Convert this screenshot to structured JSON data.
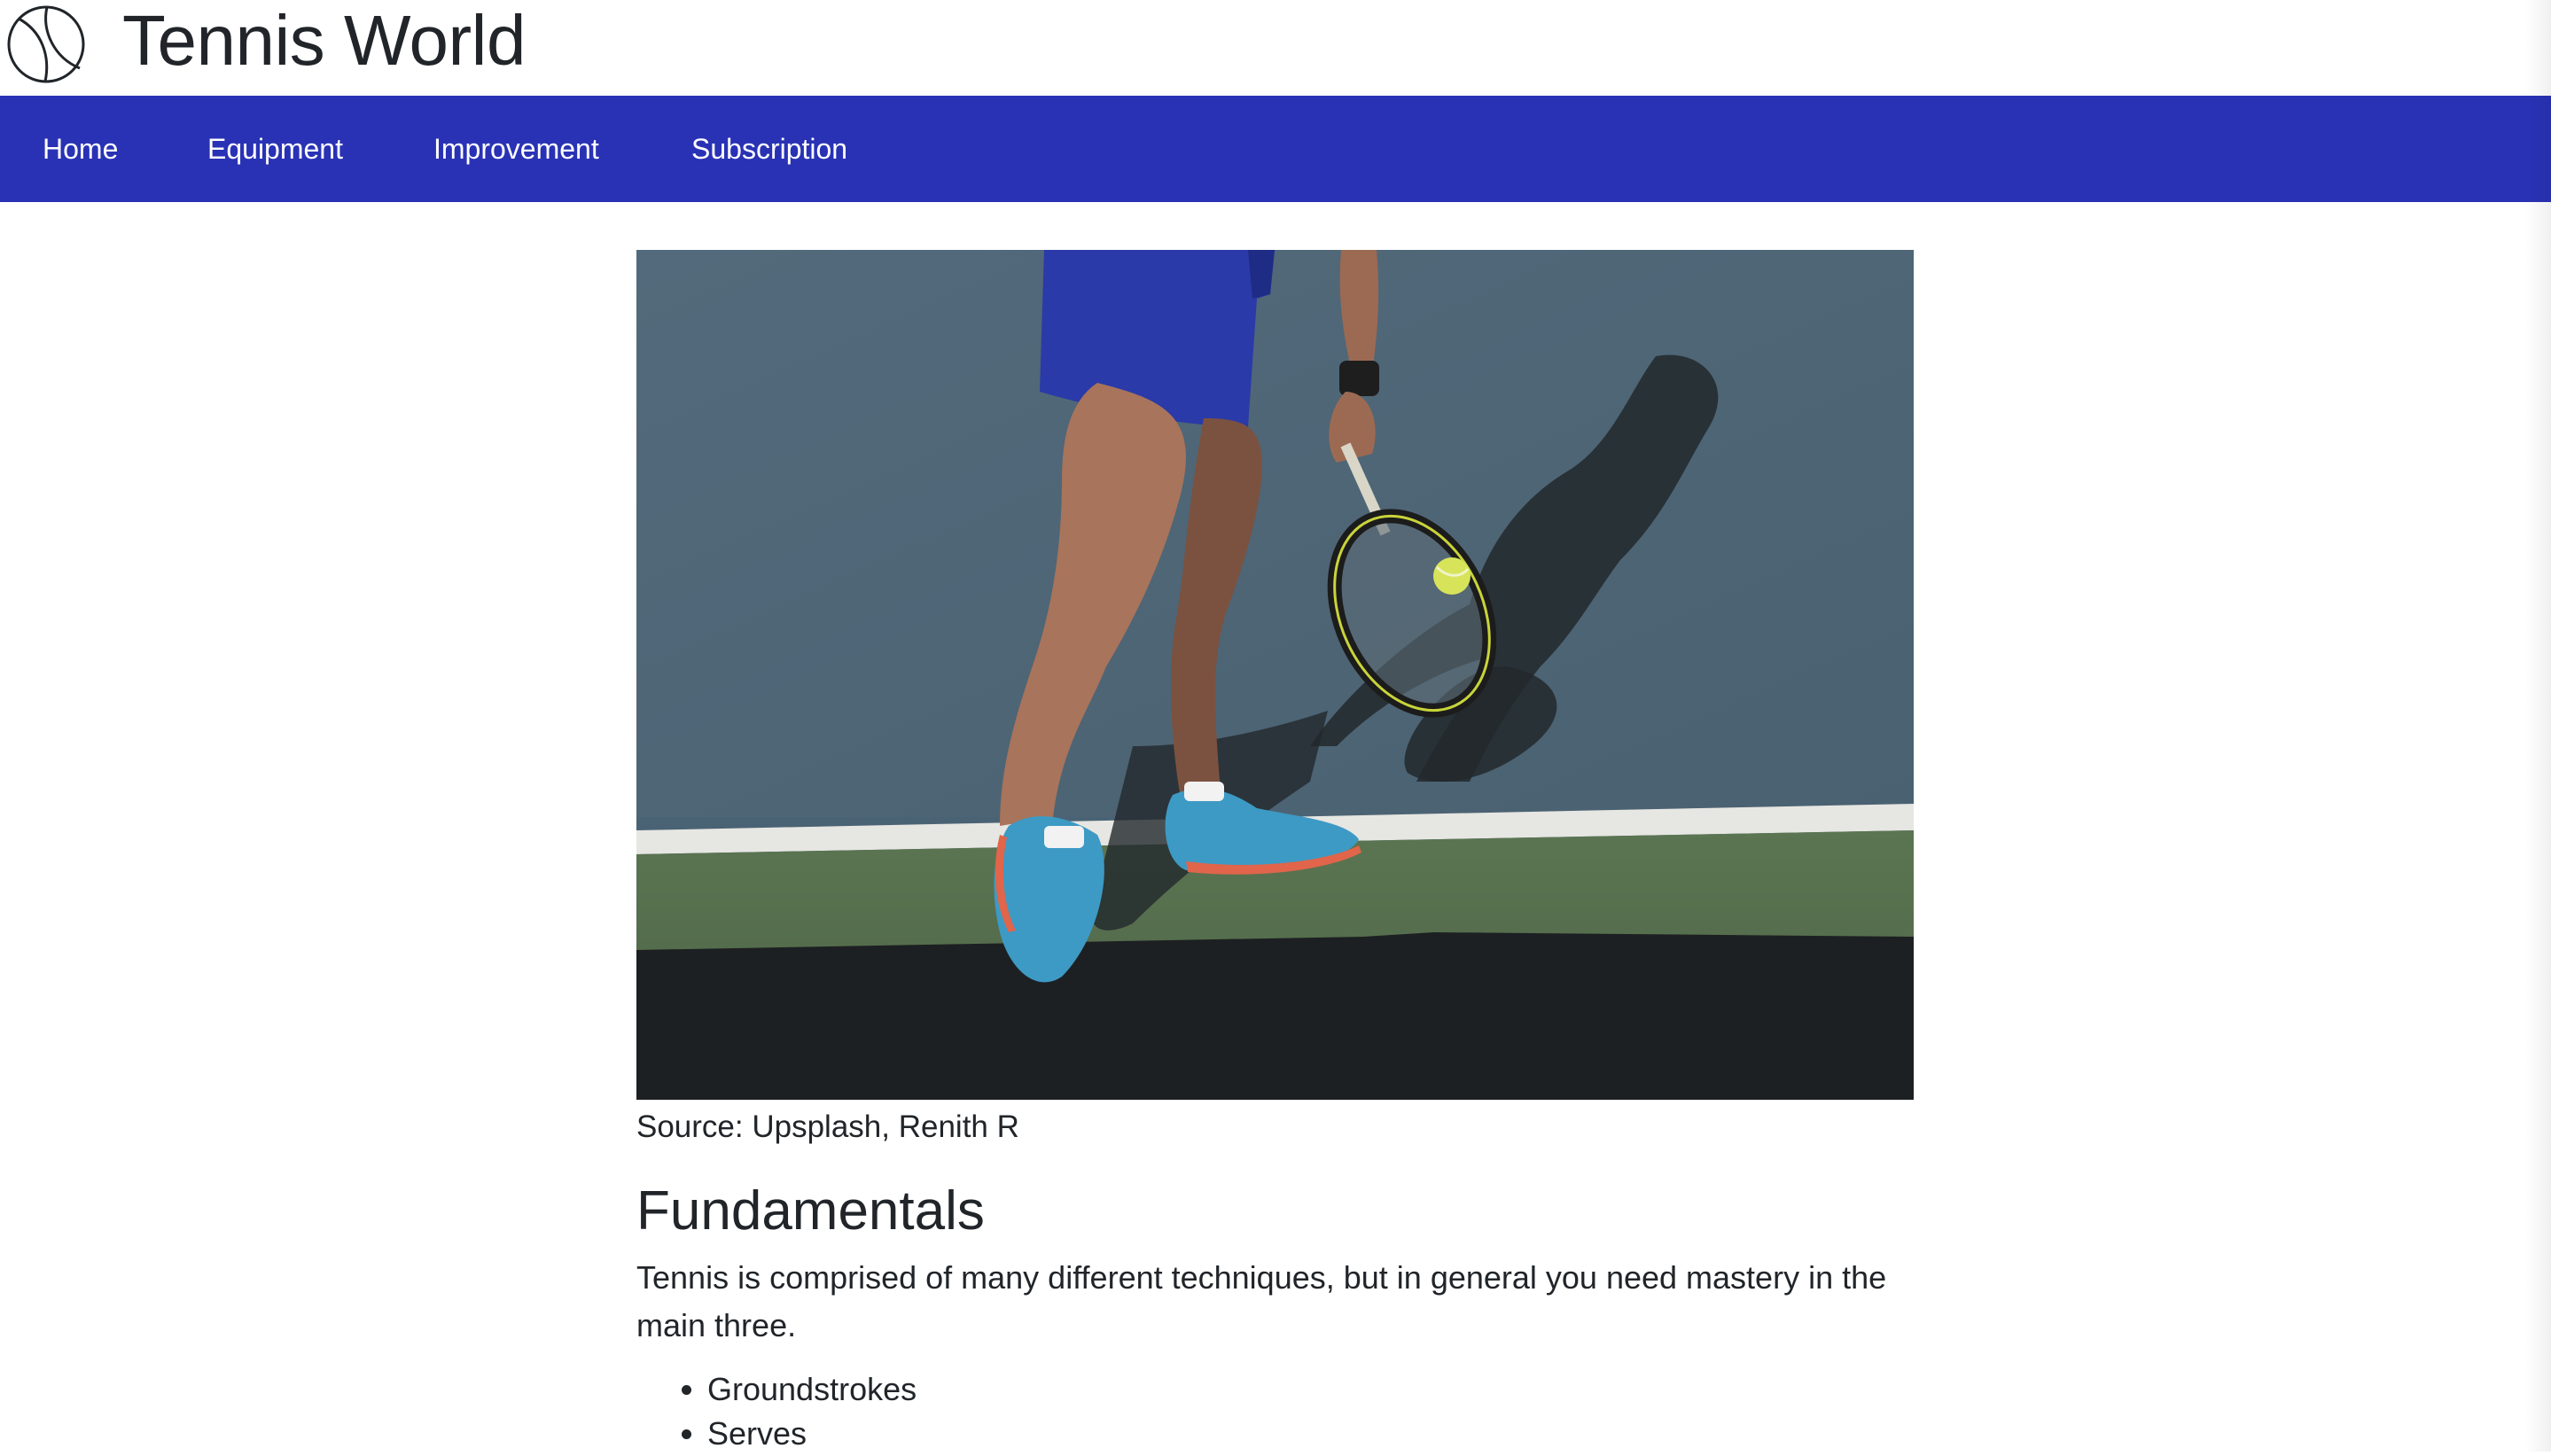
{
  "site": {
    "title": "Tennis World",
    "logo_icon": "tennis-ball-icon"
  },
  "nav": {
    "items": [
      {
        "label": "Home"
      },
      {
        "label": "Equipment"
      },
      {
        "label": "Improvement"
      },
      {
        "label": "Subscription"
      }
    ]
  },
  "colors": {
    "nav_background": "#2932b5",
    "nav_text": "#ffffff",
    "text": "#212529"
  },
  "hero": {
    "caption": "Source: Upsplash, Renith R"
  },
  "main": {
    "section_title": "Fundamentals",
    "paragraph": "Tennis is comprised of many different techniques, but in general you need mastery in the main three.",
    "techniques": [
      "Groundstrokes",
      "Serves"
    ]
  }
}
